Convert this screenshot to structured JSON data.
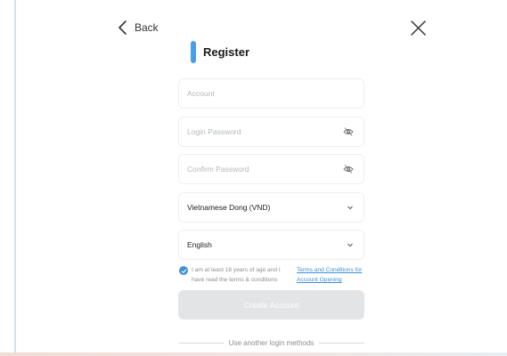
{
  "nav": {
    "back_label": "Back"
  },
  "form": {
    "title": "Register",
    "account_placeholder": "Account",
    "password_placeholder": "Login Password",
    "confirm_placeholder": "Confirm Password",
    "currency_value": "Vietnamese Dong (VND)",
    "language_value": "English",
    "agree_text": "I am at least 18 years of age and I have read the terms & conditions",
    "terms_link": "Terms and Conditions for Account Opening",
    "agree_checked": true,
    "create_button": "Create Account",
    "alt_login": "Use another login methods"
  },
  "colors": {
    "accent": "#4a9ee8",
    "link": "#3d8ed8",
    "button_disabled": "#e3e4e6"
  },
  "icons": [
    "chevron-left-icon",
    "close-icon",
    "eye-off-icon",
    "chevron-down-icon",
    "check-icon"
  ]
}
